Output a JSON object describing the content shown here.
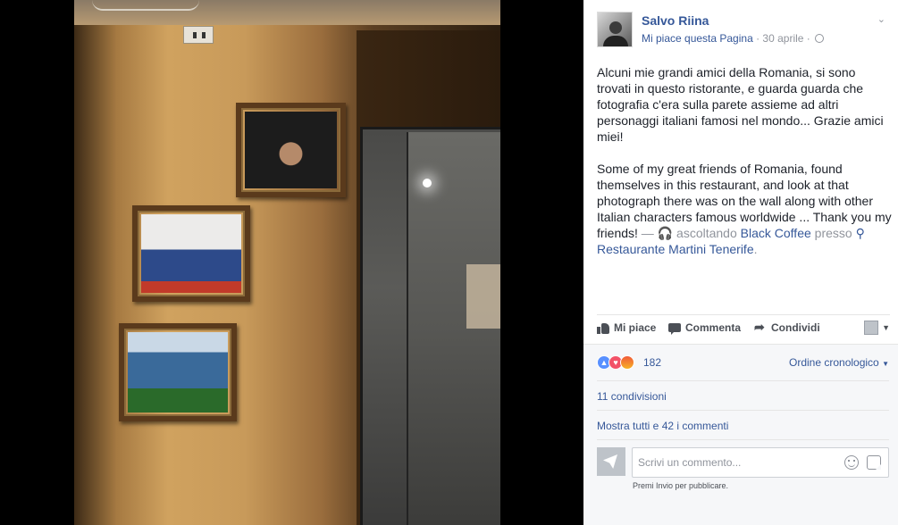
{
  "post": {
    "author": "Salvo Riina",
    "page_like": "Mi piace questa Pagina",
    "date_sep": " · ",
    "date": "30 aprile",
    "date_sep2": " · ",
    "text_it": "Alcuni mie grandi amici della Romania, si sono trovati in questo ristorante, e guarda guarda che fotografia c'era sulla parete assieme ad altri personaggi italiani famosi nel mondo... Grazie amici miei!",
    "text_en": "Some of my great friends of Romania, found themselves in this restaurant, and look at that photograph there was on the wall along with other Italian characters famous worldwide ... Thank you my friends!",
    "activity_dash": " — ",
    "activity_prefix": "ascoltando",
    "activity_link": "Black Coffee",
    "at_word": "presso",
    "location": "Restaurante Martini Tenerife",
    "location_suffix": "."
  },
  "actions": {
    "like": "Mi piace",
    "comment": "Commenta",
    "share": "Condividi"
  },
  "feedback": {
    "reaction_count": "182",
    "order": "Ordine cronologico",
    "shares": "11 condivisioni",
    "more_comments": "Mostra tutti e 42 i commenti",
    "comment_placeholder": "Scrivi un commento...",
    "hint": "Premi Invio per pubblicare."
  },
  "icons": {
    "reactions": [
      "like-reaction-icon",
      "love-reaction-icon",
      "angry-reaction-icon"
    ],
    "headphones": "🎧",
    "pin": "⚲"
  },
  "colors": {
    "link": "#365899",
    "muted": "#90949c",
    "text": "#1d2129",
    "panel_footer": "#f6f7f9"
  }
}
